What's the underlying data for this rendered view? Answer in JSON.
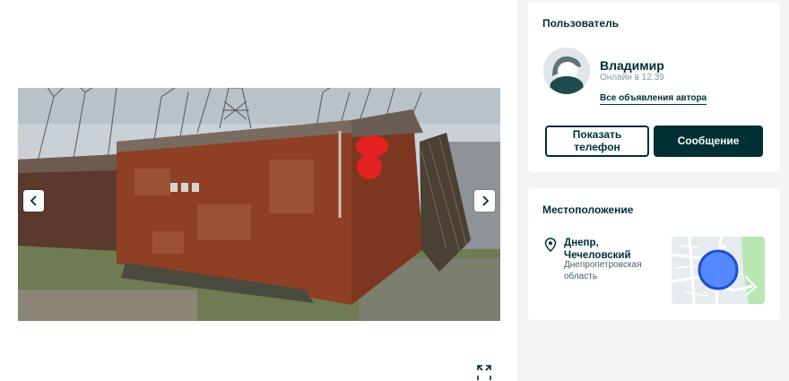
{
  "user_card": {
    "title": "Пользователь",
    "name": "Владимир",
    "online_status": "Онлайн в 12:39",
    "all_ads_link": "Все объявления автора",
    "show_phone_label": "Показать\nтелефон",
    "message_label": "Сообщение"
  },
  "location_card": {
    "title": "Местоположение",
    "city": "Днепр,\nЧечеловский",
    "region": "Днепропетровская\nобласть"
  },
  "gallery": {
    "photo": "photo of a rusty metal garage",
    "prev_icon": "chevron-left-icon",
    "next_icon": "chevron-right-icon",
    "expand_icon": "expand-icon"
  },
  "colors": {
    "brand_dark": "#002f34",
    "page_bg": "#f2f4f5",
    "card_bg": "#ffffff",
    "map_marker": "#3a77ff"
  }
}
